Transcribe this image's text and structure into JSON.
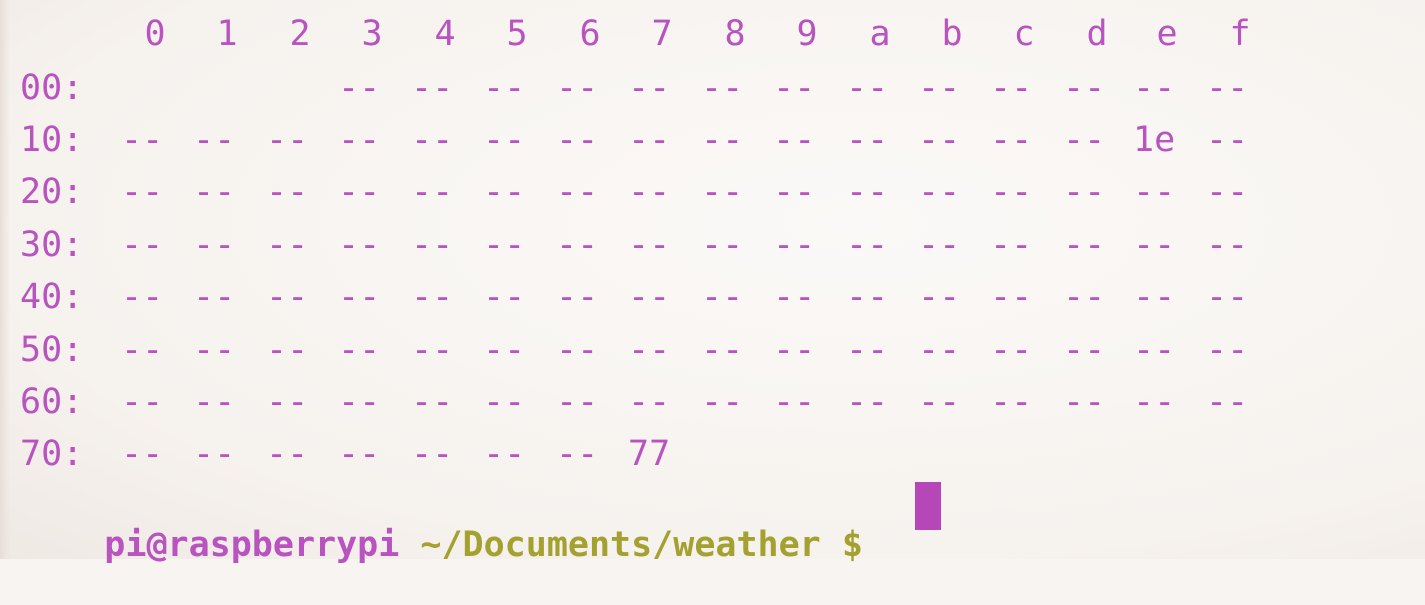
{
  "terminal": {
    "colors": {
      "background": "#f7f4f1",
      "text_magenta": "#b853bf",
      "path_olive": "#a4a130",
      "cursor": "#b547b8"
    },
    "column_headers": [
      "0",
      "1",
      "2",
      "3",
      "4",
      "5",
      "6",
      "7",
      "8",
      "9",
      "a",
      "b",
      "c",
      "d",
      "e",
      "f"
    ],
    "rows": [
      {
        "label": "00:",
        "cells": [
          "",
          "",
          "",
          "--",
          "--",
          "--",
          "--",
          "--",
          "--",
          "--",
          "--",
          "--",
          "--",
          "--",
          "--",
          "--"
        ]
      },
      {
        "label": "10:",
        "cells": [
          "--",
          "--",
          "--",
          "--",
          "--",
          "--",
          "--",
          "--",
          "--",
          "--",
          "--",
          "--",
          "--",
          "--",
          "1e",
          "--"
        ]
      },
      {
        "label": "20:",
        "cells": [
          "--",
          "--",
          "--",
          "--",
          "--",
          "--",
          "--",
          "--",
          "--",
          "--",
          "--",
          "--",
          "--",
          "--",
          "--",
          "--"
        ]
      },
      {
        "label": "30:",
        "cells": [
          "--",
          "--",
          "--",
          "--",
          "--",
          "--",
          "--",
          "--",
          "--",
          "--",
          "--",
          "--",
          "--",
          "--",
          "--",
          "--"
        ]
      },
      {
        "label": "40:",
        "cells": [
          "--",
          "--",
          "--",
          "--",
          "--",
          "--",
          "--",
          "--",
          "--",
          "--",
          "--",
          "--",
          "--",
          "--",
          "--",
          "--"
        ]
      },
      {
        "label": "50:",
        "cells": [
          "--",
          "--",
          "--",
          "--",
          "--",
          "--",
          "--",
          "--",
          "--",
          "--",
          "--",
          "--",
          "--",
          "--",
          "--",
          "--"
        ]
      },
      {
        "label": "60:",
        "cells": [
          "--",
          "--",
          "--",
          "--",
          "--",
          "--",
          "--",
          "--",
          "--",
          "--",
          "--",
          "--",
          "--",
          "--",
          "--",
          "--"
        ]
      },
      {
        "label": "70:",
        "cells": [
          "--",
          "--",
          "--",
          "--",
          "--",
          "--",
          "--",
          "77"
        ]
      }
    ],
    "prompt": {
      "user_host": "pi@raspberrypi",
      "path": "~/Documents/weather",
      "symbol": "$"
    }
  }
}
